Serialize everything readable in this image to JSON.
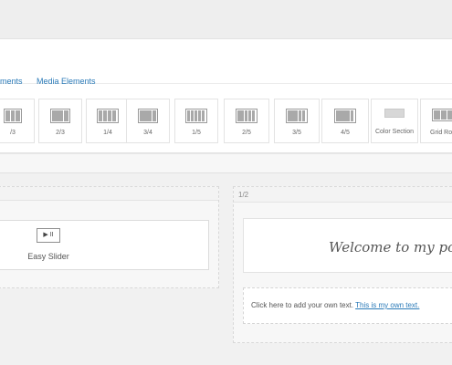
{
  "tabs": [
    {
      "label": "ments"
    },
    {
      "label": "Media Elements"
    }
  ],
  "layout_buttons": [
    {
      "label": "/3",
      "icon": "layout-column-icon"
    },
    {
      "label": "2/3",
      "icon": "layout-column-icon"
    },
    {
      "label": "1/4",
      "icon": "layout-column-icon"
    },
    {
      "label": "3/4",
      "icon": "layout-column-icon"
    },
    {
      "label": "1/5",
      "icon": "layout-column-icon"
    },
    {
      "label": "2/5",
      "icon": "layout-column-icon"
    },
    {
      "label": "3/5",
      "icon": "layout-column-icon"
    },
    {
      "label": "4/5",
      "icon": "layout-column-icon"
    },
    {
      "label": "Color Section",
      "icon": "color-section-icon"
    },
    {
      "label": "Grid Ro",
      "icon": "grid-row-icon"
    }
  ],
  "canvas": {
    "left_element": {
      "label": "Easy Slider",
      "icon_glyph": "▶ II"
    },
    "right_column": {
      "size_label": "1/2",
      "heading": "Welcome to my po",
      "text_plain": "Click here to add your own text. ",
      "text_link": "This is my own text."
    }
  }
}
